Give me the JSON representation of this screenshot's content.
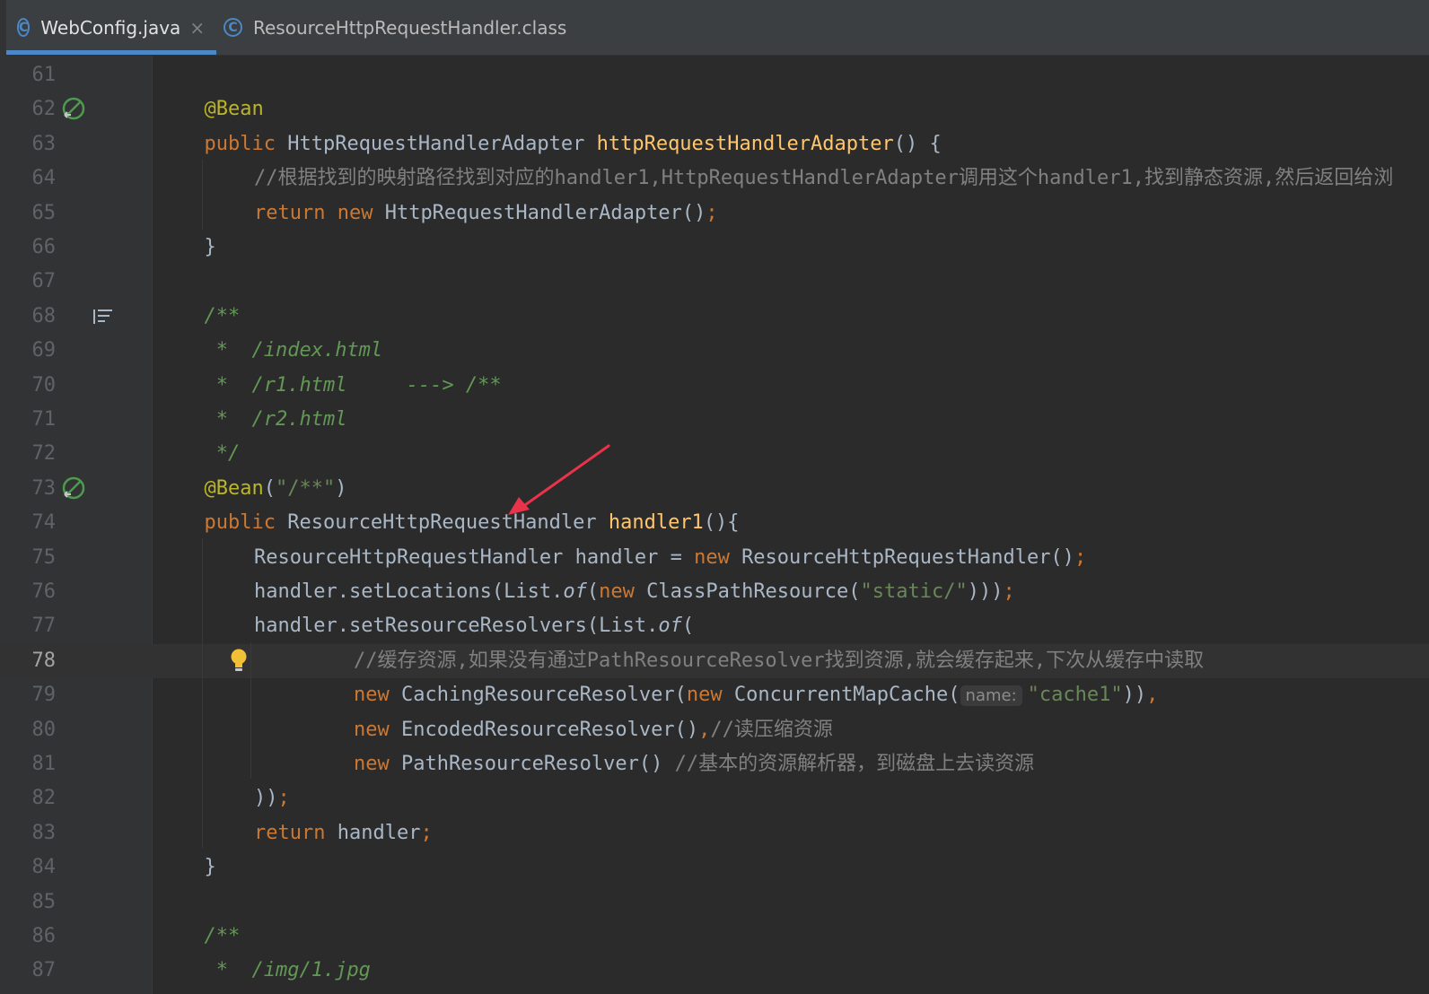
{
  "tabs": [
    {
      "label": "WebConfig.java",
      "icon": "class-icon",
      "active": true
    },
    {
      "label": "ResourceHttpRequestHandler.class",
      "icon": "class-icon",
      "active": false
    }
  ],
  "tab_icon_glyph": "C",
  "close_glyph": "×",
  "current_line": 78,
  "inlay_hint": "name:",
  "colors": {
    "background": "#2b2b2b",
    "keyword": "#cc7832",
    "annotation": "#bbb529",
    "method": "#ffc66d",
    "string": "#6a8759",
    "doc_comment": "#629755",
    "comment": "#808080",
    "default_text": "#a9b7c6",
    "active_tab_underline": "#4a88c7",
    "arrow": "#e8334a"
  },
  "lines": [
    {
      "num": "61",
      "indent": 0,
      "tokens": []
    },
    {
      "num": "62",
      "indent": 1,
      "icon": "bean-navigate-icon",
      "tokens": [
        {
          "t": "@Bean",
          "c": "ann"
        }
      ]
    },
    {
      "num": "63",
      "indent": 1,
      "tokens": [
        {
          "t": "public ",
          "c": "kw"
        },
        {
          "t": "HttpRequestHandlerAdapter "
        },
        {
          "t": "httpRequestHandlerAdapter",
          "c": "fn"
        },
        {
          "t": "() {"
        }
      ]
    },
    {
      "num": "64",
      "indent": 2,
      "tokens": [
        {
          "t": "//根据找到的映射路径找到对应的handler1,HttpRequestHandlerAdapter调用这个handler1,找到静态资源,然后返回给浏",
          "c": "cmt"
        }
      ]
    },
    {
      "num": "65",
      "indent": 2,
      "tokens": [
        {
          "t": "return ",
          "c": "kw"
        },
        {
          "t": "new ",
          "c": "kw"
        },
        {
          "t": "HttpRequestHandlerAdapter()"
        },
        {
          "t": ";",
          "c": "kw"
        }
      ]
    },
    {
      "num": "66",
      "indent": 1,
      "tokens": [
        {
          "t": "}"
        }
      ]
    },
    {
      "num": "67",
      "indent": 0,
      "tokens": []
    },
    {
      "num": "68",
      "indent": 1,
      "icon": "rendered-doc-icon",
      "tokens": [
        {
          "t": "/**",
          "c": "doc"
        }
      ]
    },
    {
      "num": "69",
      "indent": 1,
      "tokens": [
        {
          "t": " *  /index.html",
          "c": "doc"
        }
      ]
    },
    {
      "num": "70",
      "indent": 1,
      "tokens": [
        {
          "t": " *  /r1.html     ---> /**",
          "c": "doc"
        }
      ]
    },
    {
      "num": "71",
      "indent": 1,
      "tokens": [
        {
          "t": " *  /r2.html",
          "c": "doc"
        }
      ]
    },
    {
      "num": "72",
      "indent": 1,
      "tokens": [
        {
          "t": " */",
          "c": "doc"
        }
      ]
    },
    {
      "num": "73",
      "indent": 1,
      "icon": "bean-navigate-icon",
      "tokens": [
        {
          "t": "@Bean",
          "c": "ann"
        },
        {
          "t": "("
        },
        {
          "t": "\"/**\"",
          "c": "str"
        },
        {
          "t": ")"
        }
      ]
    },
    {
      "num": "74",
      "indent": 1,
      "tokens": [
        {
          "t": "public ",
          "c": "kw"
        },
        {
          "t": "ResourceHttpRequestHandler "
        },
        {
          "t": "handler1",
          "c": "fn"
        },
        {
          "t": "(){"
        }
      ]
    },
    {
      "num": "75",
      "indent": 2,
      "tokens": [
        {
          "t": "ResourceHttpRequestHandler handler = "
        },
        {
          "t": "new ",
          "c": "kw"
        },
        {
          "t": "ResourceHttpRequestHandler()"
        },
        {
          "t": ";",
          "c": "kw"
        }
      ]
    },
    {
      "num": "76",
      "indent": 2,
      "tokens": [
        {
          "t": "handler.setLocations(List."
        },
        {
          "t": "of",
          "c": "it"
        },
        {
          "t": "("
        },
        {
          "t": "new ",
          "c": "kw"
        },
        {
          "t": "ClassPathResource("
        },
        {
          "t": "\"static/\"",
          "c": "str"
        },
        {
          "t": ")))"
        },
        {
          "t": ";",
          "c": "kw"
        }
      ]
    },
    {
      "num": "77",
      "indent": 2,
      "tokens": [
        {
          "t": "handler.setResourceResolvers(List."
        },
        {
          "t": "of",
          "c": "it"
        },
        {
          "t": "("
        }
      ]
    },
    {
      "num": "78",
      "indent": 4,
      "icon": "bulb-icon",
      "tokens": [
        {
          "t": "//缓存资源,如果没有通过PathResourceResolver找到资源,就会缓存起来,下次从缓存中读取",
          "c": "cmt"
        }
      ]
    },
    {
      "num": "79",
      "indent": 4,
      "tokens": [
        {
          "t": "new ",
          "c": "kw"
        },
        {
          "t": "CachingResourceResolver("
        },
        {
          "t": "new ",
          "c": "kw"
        },
        {
          "t": "ConcurrentMapCache("
        },
        {
          "t": "name:",
          "c": "hint"
        },
        {
          "t": "\"cache1\"",
          "c": "str"
        },
        {
          "t": "))"
        },
        {
          "t": ",",
          "c": "kw"
        }
      ]
    },
    {
      "num": "80",
      "indent": 4,
      "tokens": [
        {
          "t": "new ",
          "c": "kw"
        },
        {
          "t": "EncodedResourceResolver()"
        },
        {
          "t": ",",
          "c": "kw"
        },
        {
          "t": "//读压缩资源",
          "c": "cmt"
        }
      ]
    },
    {
      "num": "81",
      "indent": 4,
      "tokens": [
        {
          "t": "new ",
          "c": "kw"
        },
        {
          "t": "PathResourceResolver() "
        },
        {
          "t": "//基本的资源解析器，到磁盘上去读资源",
          "c": "cmt"
        }
      ]
    },
    {
      "num": "82",
      "indent": 2,
      "tokens": [
        {
          "t": "))"
        },
        {
          "t": ";",
          "c": "kw"
        }
      ]
    },
    {
      "num": "83",
      "indent": 2,
      "tokens": [
        {
          "t": "return ",
          "c": "kw"
        },
        {
          "t": "handler"
        },
        {
          "t": ";",
          "c": "kw"
        }
      ]
    },
    {
      "num": "84",
      "indent": 1,
      "tokens": [
        {
          "t": "}"
        }
      ]
    },
    {
      "num": "85",
      "indent": 0,
      "tokens": []
    },
    {
      "num": "86",
      "indent": 1,
      "tokens": [
        {
          "t": "/**",
          "c": "doc"
        }
      ]
    },
    {
      "num": "87",
      "indent": 1,
      "tokens": [
        {
          "t": " *  /img/1.jpg",
          "c": "doc"
        }
      ]
    }
  ]
}
